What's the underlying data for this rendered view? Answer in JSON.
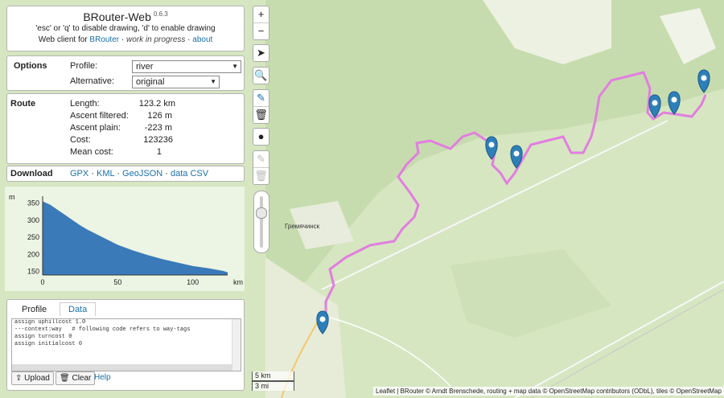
{
  "app": {
    "title": "BRouter-Web",
    "version": "0.6.3",
    "line1": "'esc' or 'q' to disable drawing, 'd' to enable drawing",
    "line2_prefix": "Web client for",
    "line2_link": "BRouter",
    "line2_sep": "·",
    "line2_em": "work in progress",
    "line2_sep2": "·",
    "line2_about": "about"
  },
  "options": {
    "heading": "Options",
    "profile_label": "Profile:",
    "profile_value": "river",
    "alternative_label": "Alternative:",
    "alternative_value": "original"
  },
  "route": {
    "heading": "Route",
    "rows": [
      {
        "label": "Length:",
        "value": "123.2 km"
      },
      {
        "label": "Ascent filtered:",
        "value": "126 m"
      },
      {
        "label": "Ascent plain:",
        "value": "-223 m"
      },
      {
        "label": "Cost:",
        "value": "123236"
      },
      {
        "label": "Mean cost:",
        "value": "1"
      }
    ]
  },
  "download": {
    "heading": "Download",
    "links": [
      "GPX",
      "KML",
      "GeoJSON",
      "data CSV"
    ],
    "sep": "·"
  },
  "elevation_chart": {
    "type": "area",
    "xlabel": "km",
    "ylabel": "m",
    "x_ticks": [
      "0",
      "50",
      "100"
    ],
    "y_ticks": [
      "350",
      "300",
      "250",
      "200",
      "150"
    ],
    "xlim": [
      0,
      123.2
    ],
    "ylim": [
      140,
      370
    ],
    "color": "#3a7ab8"
  },
  "bottom": {
    "tab_profile": "Profile",
    "tab_data": "Data",
    "code_lines": [
      "assign uphillcost 1.0",
      "",
      "---context:way   # following code refers to way-tags",
      "",
      "assign turncost 0",
      "assign initialcost 0"
    ],
    "upload_label": "Upload",
    "clear_label": "Clear",
    "help_label": "Help"
  },
  "map": {
    "town": "Гремячинск",
    "scale_km": "5 km",
    "scale_mi": "3 mi",
    "route_color": "#e27ee0",
    "marker_color": "#2d7fb8",
    "attribution": "Leaflet | BRouter © Arndt Brenschede, routing + map data © OpenStreetMap contributors (ODbL), tiles © OpenStreetMap"
  },
  "toolbar": {
    "zoom_in": "+",
    "zoom_out": "−"
  },
  "chart_data": {
    "type": "area",
    "x": [
      0,
      5,
      10,
      15,
      20,
      25,
      30,
      40,
      50,
      60,
      70,
      80,
      90,
      100,
      110,
      120,
      123.2
    ],
    "y": [
      355,
      345,
      330,
      315,
      300,
      285,
      272,
      250,
      228,
      212,
      198,
      186,
      176,
      166,
      160,
      152,
      148
    ],
    "xlabel": "km",
    "ylabel": "m",
    "xlim": [
      0,
      123.2
    ],
    "ylim": [
      140,
      370
    ]
  }
}
